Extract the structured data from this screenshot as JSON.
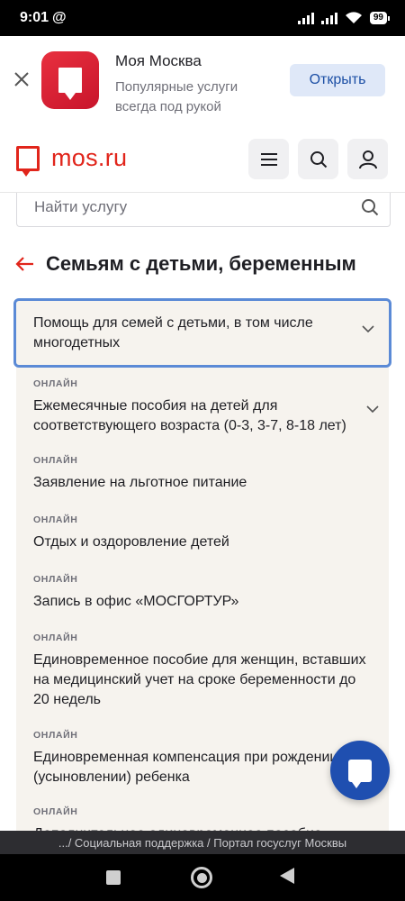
{
  "status_bar": {
    "time": "9:01",
    "at_symbol": "@",
    "battery": "99"
  },
  "app_banner": {
    "app_name": "Моя Москва",
    "description": "Популярные услуги всегда под рукой",
    "open_label": "Открыть"
  },
  "header": {
    "logo_text": "mos.ru"
  },
  "search": {
    "placeholder": "Найти услугу"
  },
  "page": {
    "title": "Семьям с детьми, беременным"
  },
  "accordion": {
    "title": "Помощь для семей с детьми, в том числе многодетных"
  },
  "services": [
    {
      "tag": "ОНЛАЙН",
      "title": "Ежемесячные пособия на детей для соответствующего возраста (0-3, 3-7, 8-18 лет)"
    },
    {
      "tag": "ОНЛАЙН",
      "title": "Заявление на льготное питание"
    },
    {
      "tag": "ОНЛАЙН",
      "title": "Отдых и оздоровление детей"
    },
    {
      "tag": "ОНЛАЙН",
      "title": "Запись в офис «МОСГОРТУР»"
    },
    {
      "tag": "ОНЛАЙН",
      "title": "Единовременное пособие для женщин, вставших на медицинский учет на сроке беременности до 20 недель"
    },
    {
      "tag": "ОНЛАЙН",
      "title": "Единовременная компенсация при рождении (усыновлении) ребенка"
    },
    {
      "tag": "ОНЛАЙН",
      "title": "Дополнительное единовременное пособие"
    }
  ],
  "breadcrumb": {
    "text": ".../ Социальная поддержка / Портал госуслуг Москвы"
  },
  "colors": {
    "brand_red": "#e1251b",
    "accent_blue": "#1f4fb0",
    "focus_border": "#5b8ad6"
  },
  "icons": [
    "close-icon",
    "menu-icon",
    "search-icon",
    "user-icon",
    "back-arrow-icon",
    "chevron-down-icon",
    "chat-icon"
  ]
}
